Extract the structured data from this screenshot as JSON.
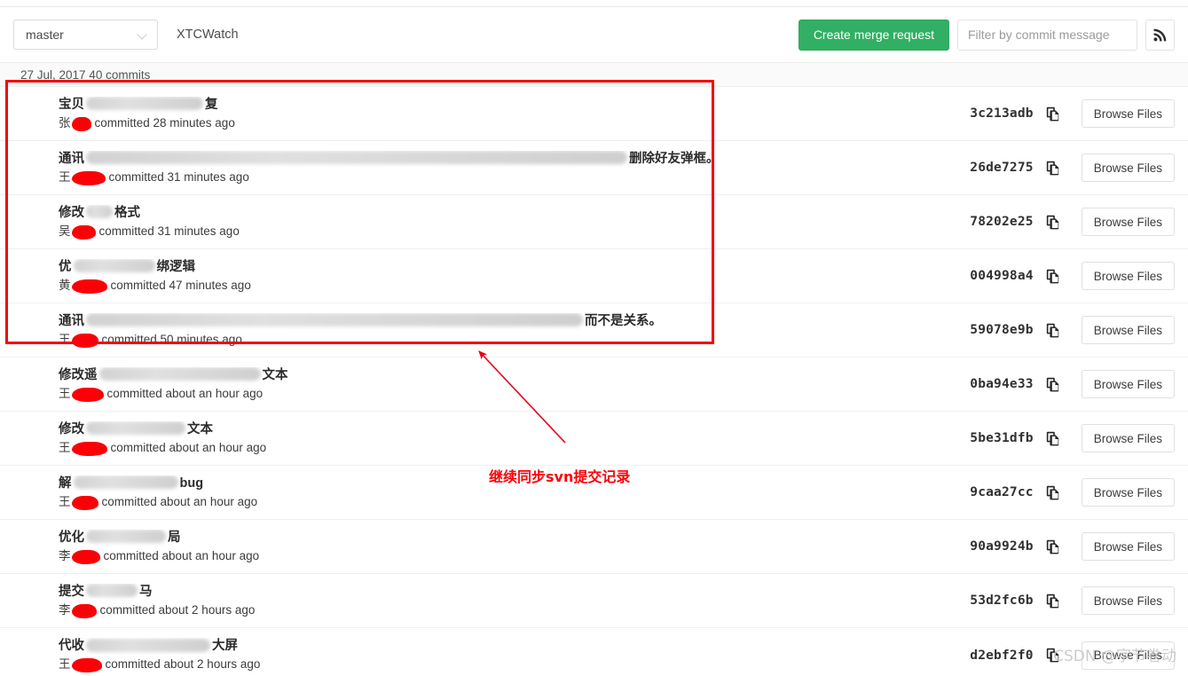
{
  "toolbar": {
    "branch": "master",
    "repo_name": "XTCWatch",
    "create_merge_request_label": "Create merge request",
    "filter_placeholder": "Filter by commit message",
    "filter_value": "",
    "rss_icon": "rss-icon",
    "chevron_icon": "chevron-down-icon"
  },
  "date_header": "27 Jul, 2017 40 commits",
  "commits": [
    {
      "title_prefix": "宝贝",
      "title_suffix": "复",
      "title_blur_width": 132,
      "author_prefix": "张",
      "author_redact_width": 22,
      "time": "committed 28 minutes ago",
      "hash": "3c213adb",
      "browse_label": "Browse Files",
      "avatar_color": "#1d5c1d",
      "avatar_style": "blob"
    },
    {
      "title_prefix": "通讯",
      "title_suffix": "删除好友弹框。",
      "title_blur_width": 610,
      "author_prefix": "王",
      "author_redact_width": 38,
      "time": "committed 31 minutes ago",
      "hash": "26de7275",
      "browse_label": "Browse Files",
      "avatar_color": "#4aa84a",
      "avatar_style": "grid"
    },
    {
      "title_prefix": "修改",
      "title_suffix": "格式",
      "title_blur_width": 30,
      "author_prefix": "吴",
      "author_redact_width": 27,
      "time": "committed 31 minutes ago",
      "hash": "78202e25",
      "browse_label": "Browse Files",
      "avatar_color": "#e8672a",
      "avatar_style": "diamond"
    },
    {
      "title_prefix": "优",
      "title_suffix": "绑逻辑",
      "title_blur_width": 92,
      "author_prefix": "黄",
      "author_redact_width": 40,
      "time": "committed 47 minutes ago",
      "hash": "004998a4",
      "browse_label": "Browse Files",
      "avatar_color": "#2e21c4",
      "avatar_style": "diamond"
    },
    {
      "title_prefix": "通讯",
      "title_suffix": "而不是关系。",
      "title_blur_width": 560,
      "author_prefix": "王",
      "author_redact_width": 30,
      "time": "committed 50 minutes ago",
      "hash": "59078e9b",
      "browse_label": "Browse Files",
      "avatar_color": "#4aa84a",
      "avatar_style": "grid"
    },
    {
      "title_prefix": "修改遥",
      "title_suffix": "文本",
      "title_blur_width": 182,
      "author_prefix": "王",
      "author_redact_width": 36,
      "time": "committed about an hour ago",
      "hash": "0ba94e33",
      "browse_label": "Browse Files",
      "avatar_color": "#4aa84a",
      "avatar_style": "grid"
    },
    {
      "title_prefix": "修改",
      "title_suffix": "文本",
      "title_blur_width": 112,
      "author_prefix": "王",
      "author_redact_width": 40,
      "time": "committed about an hour ago",
      "hash": "5be31dfb",
      "browse_label": "Browse Files",
      "avatar_color": "#4aa84a",
      "avatar_style": "grid"
    },
    {
      "title_prefix": "解",
      "title_suffix": "bug",
      "title_blur_width": 118,
      "author_prefix": "王",
      "author_redact_width": 30,
      "time": "committed about an hour ago",
      "hash": "9caa27cc",
      "browse_label": "Browse Files",
      "avatar_color": "#4aa84a",
      "avatar_style": "grid"
    },
    {
      "title_prefix": "优化",
      "title_suffix": "局",
      "title_blur_width": 90,
      "author_prefix": "李",
      "author_redact_width": 32,
      "time": "committed about an hour ago",
      "hash": "90a9924b",
      "browse_label": "Browse Files",
      "avatar_color": "#b59a4e",
      "avatar_style": "zigzag"
    },
    {
      "title_prefix": "提交",
      "title_suffix": "马",
      "title_blur_width": 58,
      "author_prefix": "李",
      "author_redact_width": 28,
      "time": "committed about 2 hours ago",
      "hash": "53d2fc6b",
      "browse_label": "Browse Files",
      "avatar_color": "#a843c8",
      "avatar_style": "star"
    },
    {
      "title_prefix": "代收",
      "title_suffix": "大屏",
      "title_blur_width": 140,
      "author_prefix": "王",
      "author_redact_width": 34,
      "time": "committed about 2 hours ago",
      "hash": "d2ebf2f0",
      "browse_label": "Browse Files",
      "avatar_color": "#4aa84a",
      "avatar_style": "grid"
    }
  ],
  "annotations": {
    "highlight_box_color": "#f5000b",
    "arrow_color": "#e8001a",
    "note_text": "继续同步svn提交记录"
  },
  "watermark": "CSDN @字节卷动"
}
